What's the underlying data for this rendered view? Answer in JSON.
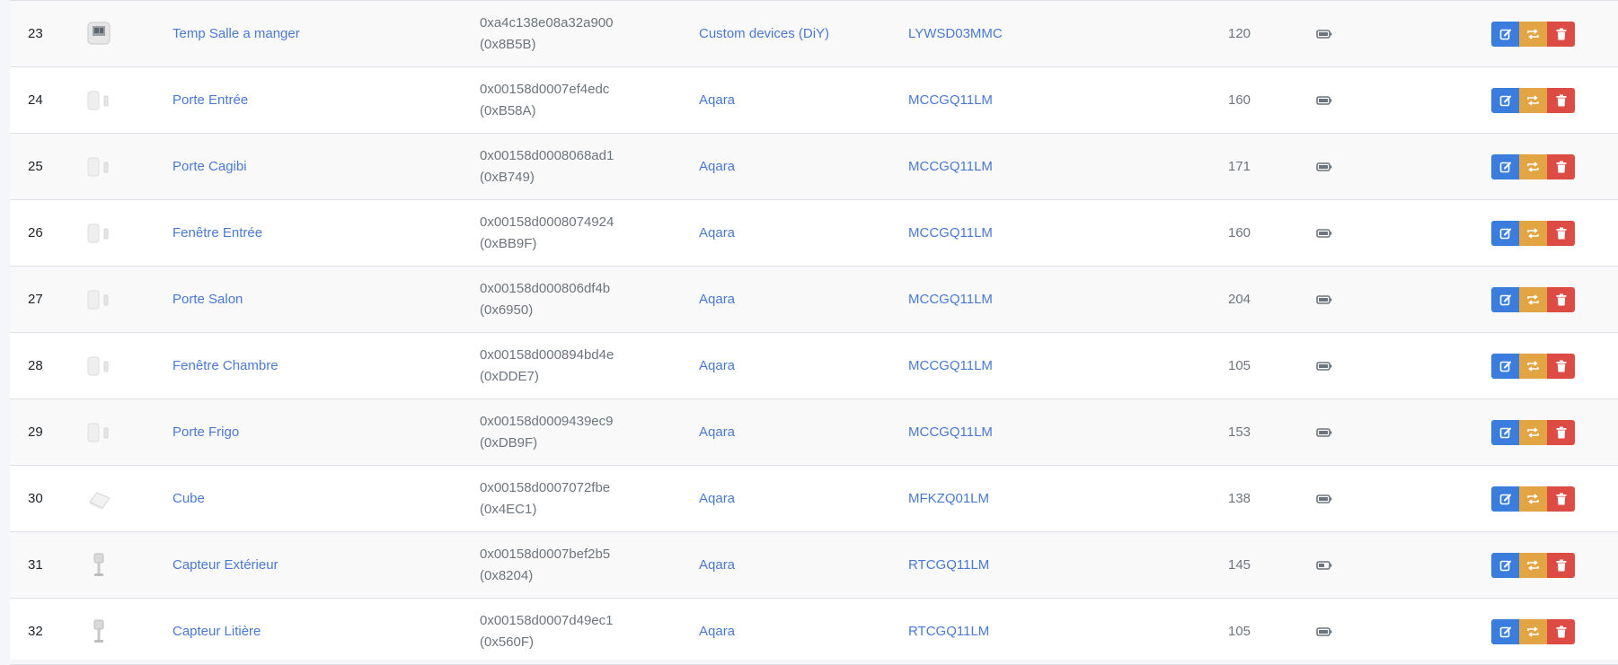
{
  "colors": {
    "link": "#4a79d4",
    "edit": "#3b7ddd",
    "swap": "#e3a443",
    "delete": "#dc4c44"
  },
  "devices": [
    {
      "id": "23",
      "image": "thermometer-sensor",
      "name": "Temp Salle a manger",
      "ieee": "0xa4c138e08a32a900",
      "nwk": "(0x8B5B)",
      "manufacturer": "Custom devices (DiY)",
      "model": "LYWSD03MMC",
      "lqi": "120",
      "power": "battery-icon"
    },
    {
      "id": "24",
      "image": "door-sensor",
      "name": "Porte Entrée",
      "ieee": "0x00158d0007ef4edc",
      "nwk": "(0xB58A)",
      "manufacturer": "Aqara",
      "model": "MCCGQ11LM",
      "lqi": "160",
      "power": "battery-icon"
    },
    {
      "id": "25",
      "image": "door-sensor",
      "name": "Porte Cagibi",
      "ieee": "0x00158d0008068ad1",
      "nwk": "(0xB749)",
      "manufacturer": "Aqara",
      "model": "MCCGQ11LM",
      "lqi": "171",
      "power": "battery-icon"
    },
    {
      "id": "26",
      "image": "door-sensor",
      "name": "Fenêtre Entrée",
      "ieee": "0x00158d0008074924",
      "nwk": "(0xBB9F)",
      "manufacturer": "Aqara",
      "model": "MCCGQ11LM",
      "lqi": "160",
      "power": "battery-icon"
    },
    {
      "id": "27",
      "image": "door-sensor",
      "name": "Porte Salon",
      "ieee": "0x00158d000806df4b",
      "nwk": "(0x6950)",
      "manufacturer": "Aqara",
      "model": "MCCGQ11LM",
      "lqi": "204",
      "power": "battery-icon"
    },
    {
      "id": "28",
      "image": "door-sensor",
      "name": "Fenêtre Chambre",
      "ieee": "0x00158d000894bd4e",
      "nwk": "(0xDDE7)",
      "manufacturer": "Aqara",
      "model": "MCCGQ11LM",
      "lqi": "105",
      "power": "battery-icon"
    },
    {
      "id": "29",
      "image": "door-sensor",
      "name": "Porte Frigo",
      "ieee": "0x00158d0009439ec9",
      "nwk": "(0xDB9F)",
      "manufacturer": "Aqara",
      "model": "MCCGQ11LM",
      "lqi": "153",
      "power": "battery-icon"
    },
    {
      "id": "30",
      "image": "cube-controller",
      "name": "Cube",
      "ieee": "0x00158d0007072fbe",
      "nwk": "(0x4EC1)",
      "manufacturer": "Aqara",
      "model": "MFKZQ01LM",
      "lqi": "138",
      "power": "battery-icon"
    },
    {
      "id": "31",
      "image": "temp-probe-sensor",
      "name": "Capteur Extérieur",
      "ieee": "0x00158d0007bef2b5",
      "nwk": "(0x8204)",
      "manufacturer": "Aqara",
      "model": "RTCGQ11LM",
      "lqi": "145",
      "power": "battery-half-icon"
    },
    {
      "id": "32",
      "image": "temp-probe-sensor",
      "name": "Capteur Litière",
      "ieee": "0x00158d0007d49ec1",
      "nwk": "(0x560F)",
      "manufacturer": "Aqara",
      "model": "RTCGQ11LM",
      "lqi": "105",
      "power": "battery-icon"
    }
  ]
}
